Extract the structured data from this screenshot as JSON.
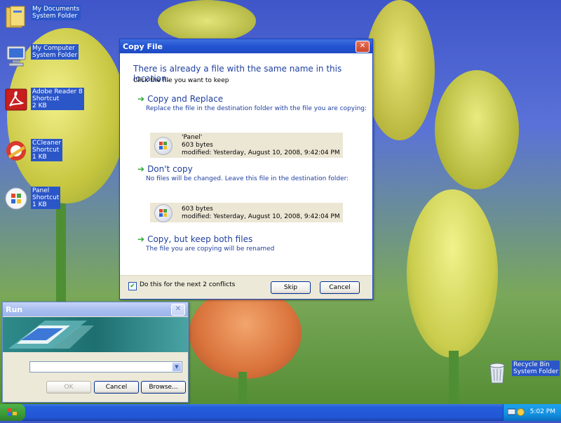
{
  "desktop": {
    "icons": [
      {
        "name": "My Documents",
        "sub1": "System Folder",
        "sub2": ""
      },
      {
        "name": "My Computer",
        "sub1": "System Folder",
        "sub2": ""
      },
      {
        "name": "Adobe Reader 8",
        "sub1": "Shortcut",
        "sub2": "2 KB"
      },
      {
        "name": "CCleaner",
        "sub1": "Shortcut",
        "sub2": "1 KB"
      },
      {
        "name": "Panel",
        "sub1": "Shortcut",
        "sub2": "1 KB"
      },
      {
        "name": "Recycle Bin",
        "sub1": "System Folder",
        "sub2": ""
      }
    ]
  },
  "copy_dialog": {
    "title": "Copy File",
    "close_glyph": "✕",
    "heading": "There is already a file with the same name in this location.",
    "subheading": "Click the file you want to keep",
    "options": [
      {
        "arrow": "➔",
        "title": "Copy and Replace",
        "desc": "Replace the file in the destination folder with the file you are copying:",
        "file": {
          "name": "'Panel'",
          "size": "603 bytes",
          "modified": "modified: Yesterday, August 10, 2008, 9:42:04 PM"
        }
      },
      {
        "arrow": "➔",
        "title": "Don't copy",
        "desc": "No files will be changed. Leave this file in the destination folder:",
        "file": {
          "size": "603 bytes",
          "modified": "modified: Yesterday, August 10, 2008, 9:42:04 PM"
        }
      },
      {
        "arrow": "➔",
        "title": "Copy, but keep both files",
        "desc": "The file you are copying will be renamed"
      }
    ],
    "checkbox": {
      "checked_glyph": "✔",
      "label": "Do this for the next 2 conflicts"
    },
    "buttons": {
      "skip": "Skip",
      "cancel": "Cancel"
    }
  },
  "run_dialog": {
    "title": "Run",
    "close_glyph": "✕",
    "dropdown_glyph": "▼",
    "input_value": "",
    "buttons": {
      "ok": "OK",
      "cancel": "Cancel",
      "browse": "Browse..."
    }
  },
  "taskbar": {
    "clock": "5:02 PM"
  },
  "colors": {
    "title_blue": "#2354d1",
    "link_blue": "#1f3fa0",
    "arrow_green": "#2aa632"
  }
}
